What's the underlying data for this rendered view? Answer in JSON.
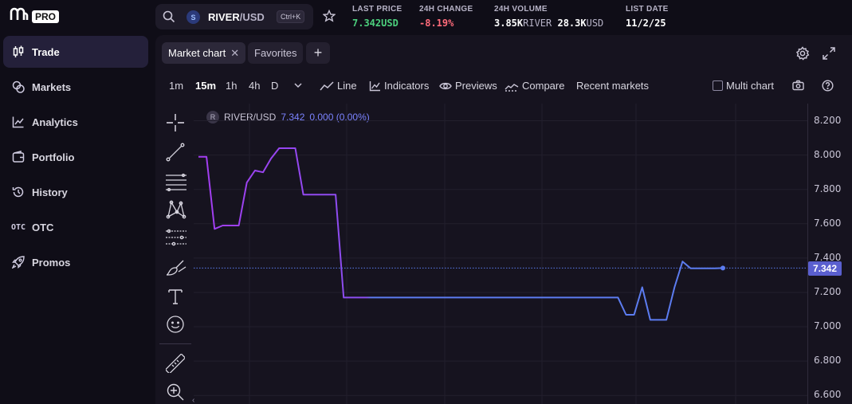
{
  "app": {
    "logo_mark": "m",
    "logo_badge": "PRO"
  },
  "sidebar": {
    "items": [
      {
        "label": "Trade",
        "icon": "candlestick-icon",
        "active": true
      },
      {
        "label": "Markets",
        "icon": "coins-icon"
      },
      {
        "label": "Analytics",
        "icon": "line-chart-icon"
      },
      {
        "label": "Portfolio",
        "icon": "wallet-icon"
      },
      {
        "label": "History",
        "icon": "history-icon"
      },
      {
        "label": "OTC",
        "icon": "otc-icon",
        "icon_text": "OTC"
      },
      {
        "label": "Promos",
        "icon": "rocket-icon"
      }
    ]
  },
  "header": {
    "pair_base": "RIVER",
    "pair_quote": "/USD",
    "coin_glyph": "S",
    "shortcut": "Ctrl+K",
    "stats": [
      {
        "label": "LAST PRICE",
        "value": "7.342",
        "unit": "USD"
      },
      {
        "label": "24H CHANGE",
        "value": "-8.19%"
      },
      {
        "label": "24H VOLUME",
        "value": "3.85K",
        "unit": "RIVER",
        "value2": "28.3K",
        "unit2": "USD"
      },
      {
        "label": "LIST DATE",
        "value": "11/2/25"
      }
    ]
  },
  "tabs": [
    {
      "label": "Market chart",
      "active": true,
      "closable": true
    },
    {
      "label": "Favorites"
    }
  ],
  "add_tab": "+",
  "toolbar": {
    "intervals": [
      "1m",
      "15m",
      "1h",
      "4h",
      "D"
    ],
    "selected_interval": "15m",
    "line": "Line",
    "indicators": "Indicators",
    "previews": "Previews",
    "compare": "Compare",
    "recent": "Recent markets",
    "multi_chart": "Multi chart"
  },
  "legend": {
    "badge": "R",
    "symbol": "RIVER/USD",
    "price": "7.342",
    "change": "0.000 (0.00%)"
  },
  "chart_data": {
    "type": "line",
    "ylim": [
      6.55,
      8.3
    ],
    "yticks": [
      "8.200",
      "8.000",
      "7.800",
      "7.600",
      "7.400",
      "7.200",
      "7.000",
      "6.800",
      "6.600"
    ],
    "last_price_label": "7.342",
    "last_value": 7.342,
    "series": [
      {
        "values": [
          7.99,
          7.99,
          7.57,
          7.59,
          7.59,
          7.59,
          7.84,
          7.91,
          7.9,
          7.98,
          8.04,
          8.04,
          8.04,
          7.77,
          7.77,
          7.77,
          7.77,
          7.77,
          7.17,
          7.17,
          7.17,
          7.17,
          7.17,
          7.17,
          7.17,
          7.17,
          7.17,
          7.17,
          7.17,
          7.17,
          7.17,
          7.17,
          7.17,
          7.17,
          7.17,
          7.17,
          7.17,
          7.17,
          7.17,
          7.17,
          7.17,
          7.17,
          7.17,
          7.17,
          7.17,
          7.17,
          7.17,
          7.17,
          7.17,
          7.17,
          7.17,
          7.17,
          7.17,
          7.07,
          7.07,
          7.23,
          7.04,
          7.04,
          7.04,
          7.23,
          7.38,
          7.34,
          7.34,
          7.34,
          7.34,
          7.342
        ],
        "color_start": "#a33df0",
        "color_end": "#5c7cf0"
      }
    ]
  }
}
